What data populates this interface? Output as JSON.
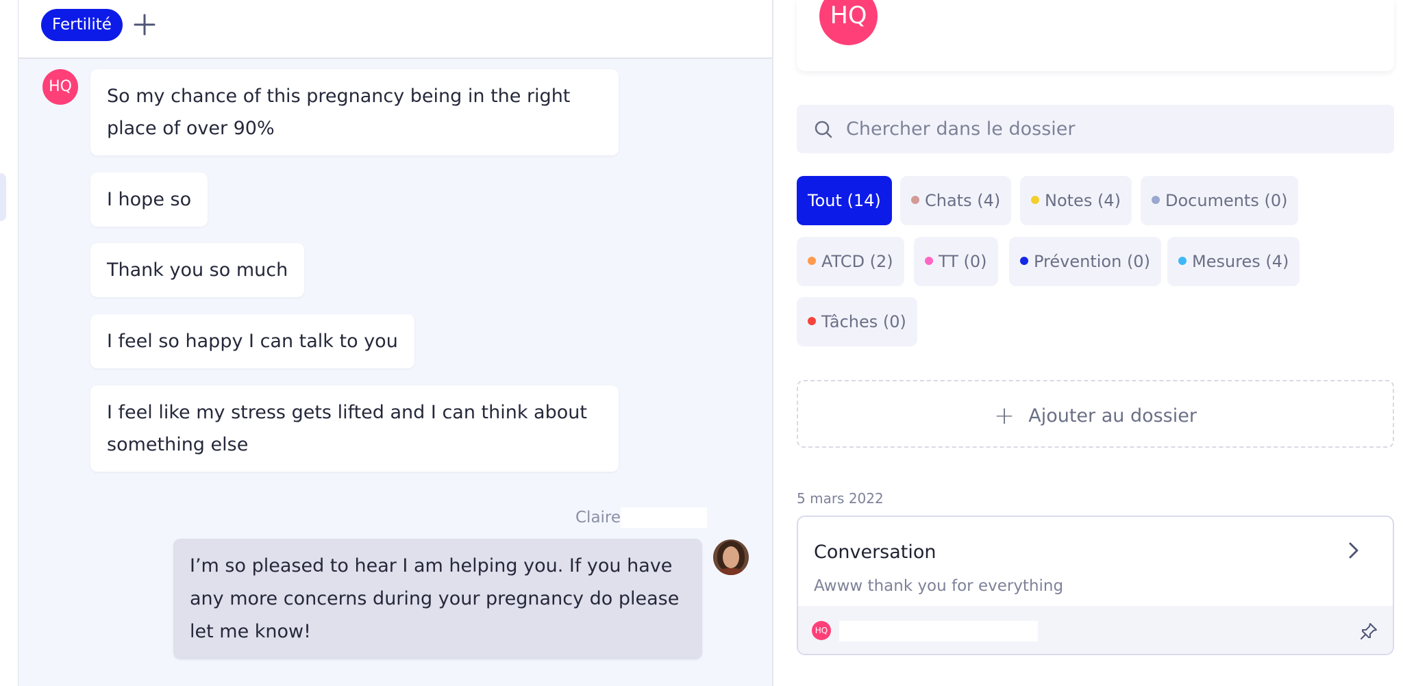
{
  "chat": {
    "tag": "Fertilité",
    "add_tag_icon": "plus-icon",
    "patient_initials": "HQ",
    "messages": [
      {
        "text": "So my chance of this pregnancy being in the right place of over 90%"
      },
      {
        "text": "I hope so"
      },
      {
        "text": "Thank you so much"
      },
      {
        "text": "I feel so happy I can talk to you"
      },
      {
        "text": "I feel like my stress gets lifted and I can think about something else"
      }
    ],
    "reply": {
      "sender": "Claire",
      "text": "I’m so pleased to hear I am helping you. If you have any more concerns during your pregnancy do please let me know!"
    }
  },
  "dossier": {
    "avatar_initials": "HQ",
    "search_placeholder": "Chercher dans le dossier",
    "filters": [
      {
        "label": "Tout (14)",
        "active": true,
        "dot_color": ""
      },
      {
        "label": "Chats (4)",
        "active": false,
        "dot_color": "#d49a95"
      },
      {
        "label": "Notes (4)",
        "active": false,
        "dot_color": "#f2cf2c"
      },
      {
        "label": "Documents (0)",
        "active": false,
        "dot_color": "#9aa7cf"
      },
      {
        "label": "ATCD (2)",
        "active": false,
        "dot_color": "#ff9a4d"
      },
      {
        "label": "TT (0)",
        "active": false,
        "dot_color": "#ff66c4"
      },
      {
        "label": "Prévention (0)",
        "active": false,
        "dot_color": "#1428e6"
      },
      {
        "label": "Mesures (4)",
        "active": false,
        "dot_color": "#3fb8f5"
      },
      {
        "label": "Tâches (0)",
        "active": false,
        "dot_color": "#f5443b"
      }
    ],
    "add_label": "Ajouter au dossier",
    "date": "5 mars 2022",
    "entry": {
      "title": "Conversation",
      "preview": "Awww thank you for everything",
      "author_initials": "HQ"
    }
  },
  "colors": {
    "accent": "#0d1be8",
    "avatar": "#ff3f78",
    "chat_bg": "#f3f6fd"
  }
}
